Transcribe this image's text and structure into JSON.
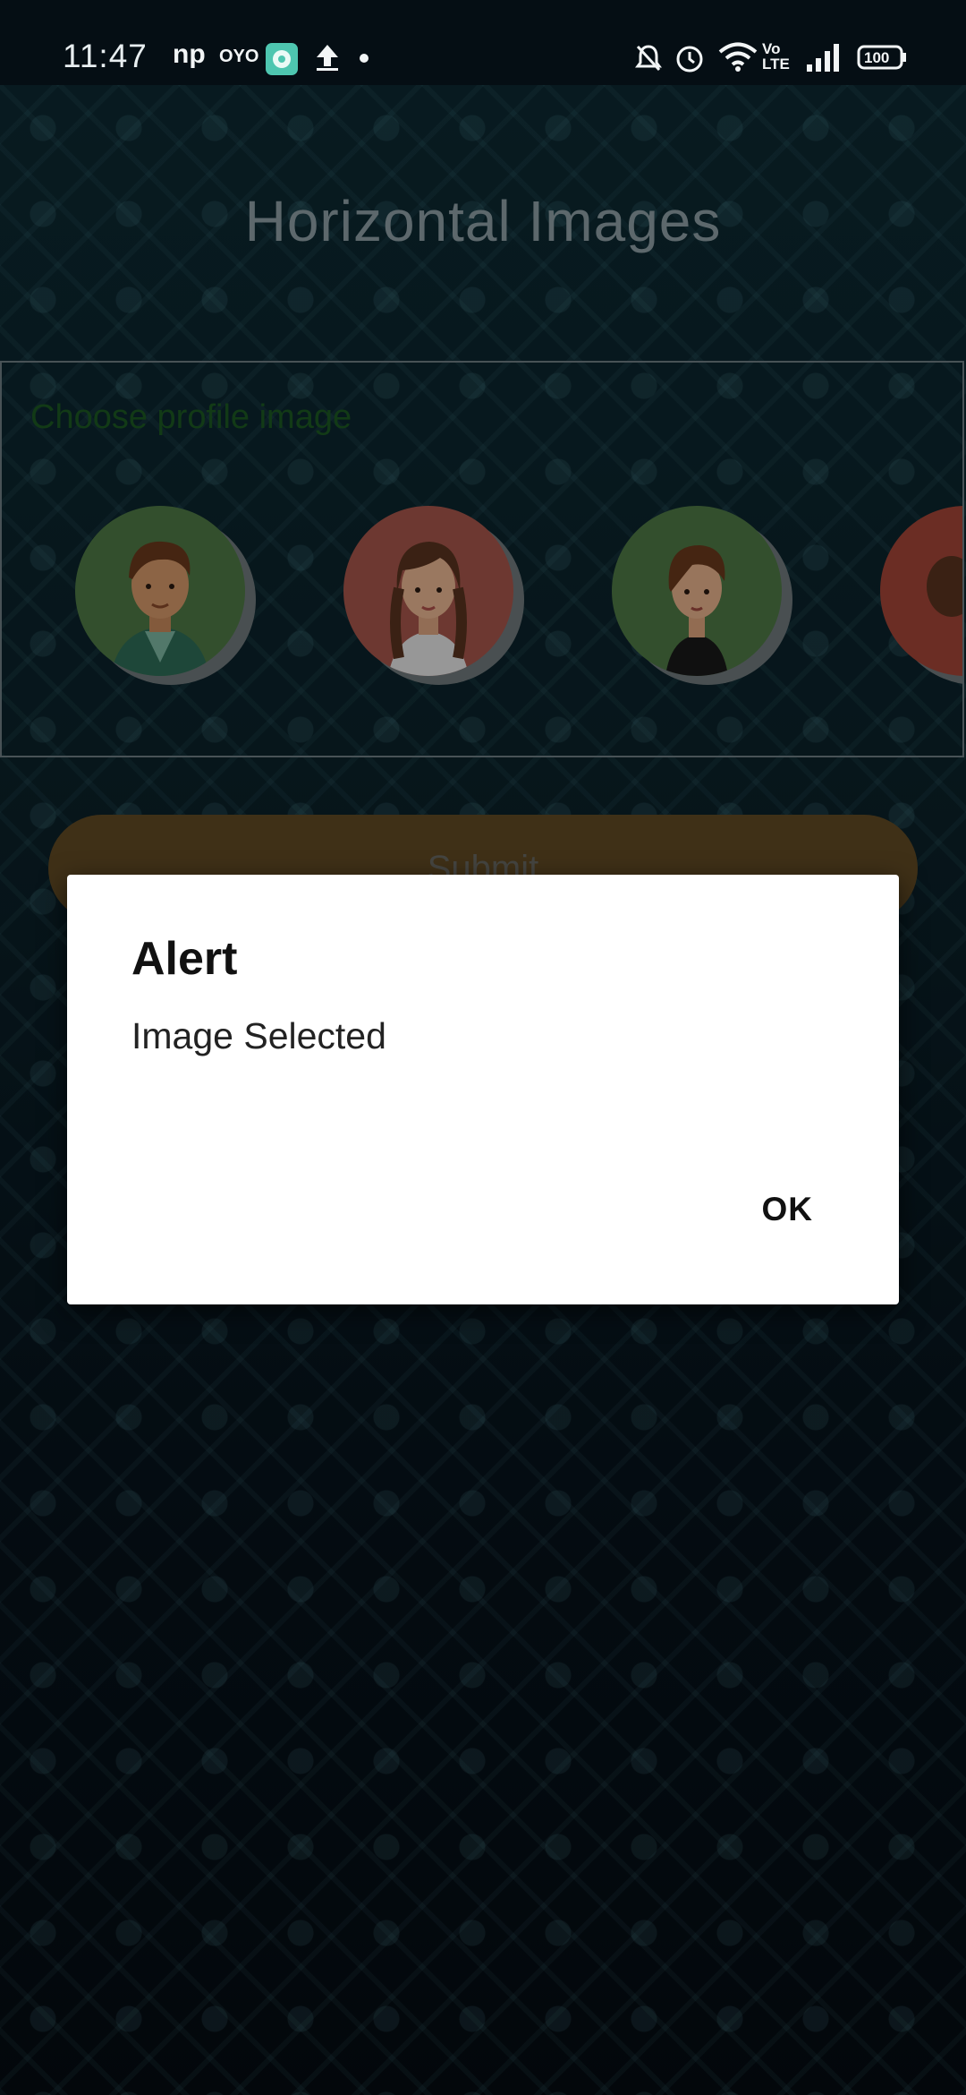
{
  "status_bar": {
    "time": "11:47",
    "left_icons": [
      "np-app-icon",
      "oyo-app-icon",
      "chat-app-icon",
      "upload-icon",
      "dot-icon"
    ],
    "right_icons": [
      "mute-bell-icon",
      "alarm-icon",
      "wifi-icon",
      "volte-icon",
      "signal-icon",
      "battery-icon"
    ],
    "battery_level": "100"
  },
  "app": {
    "title": "Horizontal Images",
    "picker_label": "Choose profile image",
    "submit_label": "Submit"
  },
  "avatars": [
    {
      "name": "avatar-boy",
      "bg": "#4f7a45"
    },
    {
      "name": "avatar-girl-braids",
      "bg": "#a8574c"
    },
    {
      "name": "avatar-girl-short",
      "bg": "#4f7a45"
    },
    {
      "name": "avatar-partial",
      "bg": "#a54638"
    }
  ],
  "dialog": {
    "title": "Alert",
    "message": "Image Selected",
    "ok_label": "OK"
  },
  "colors": {
    "accent_submit": "#624a24",
    "label_green": "#1c5a22"
  }
}
